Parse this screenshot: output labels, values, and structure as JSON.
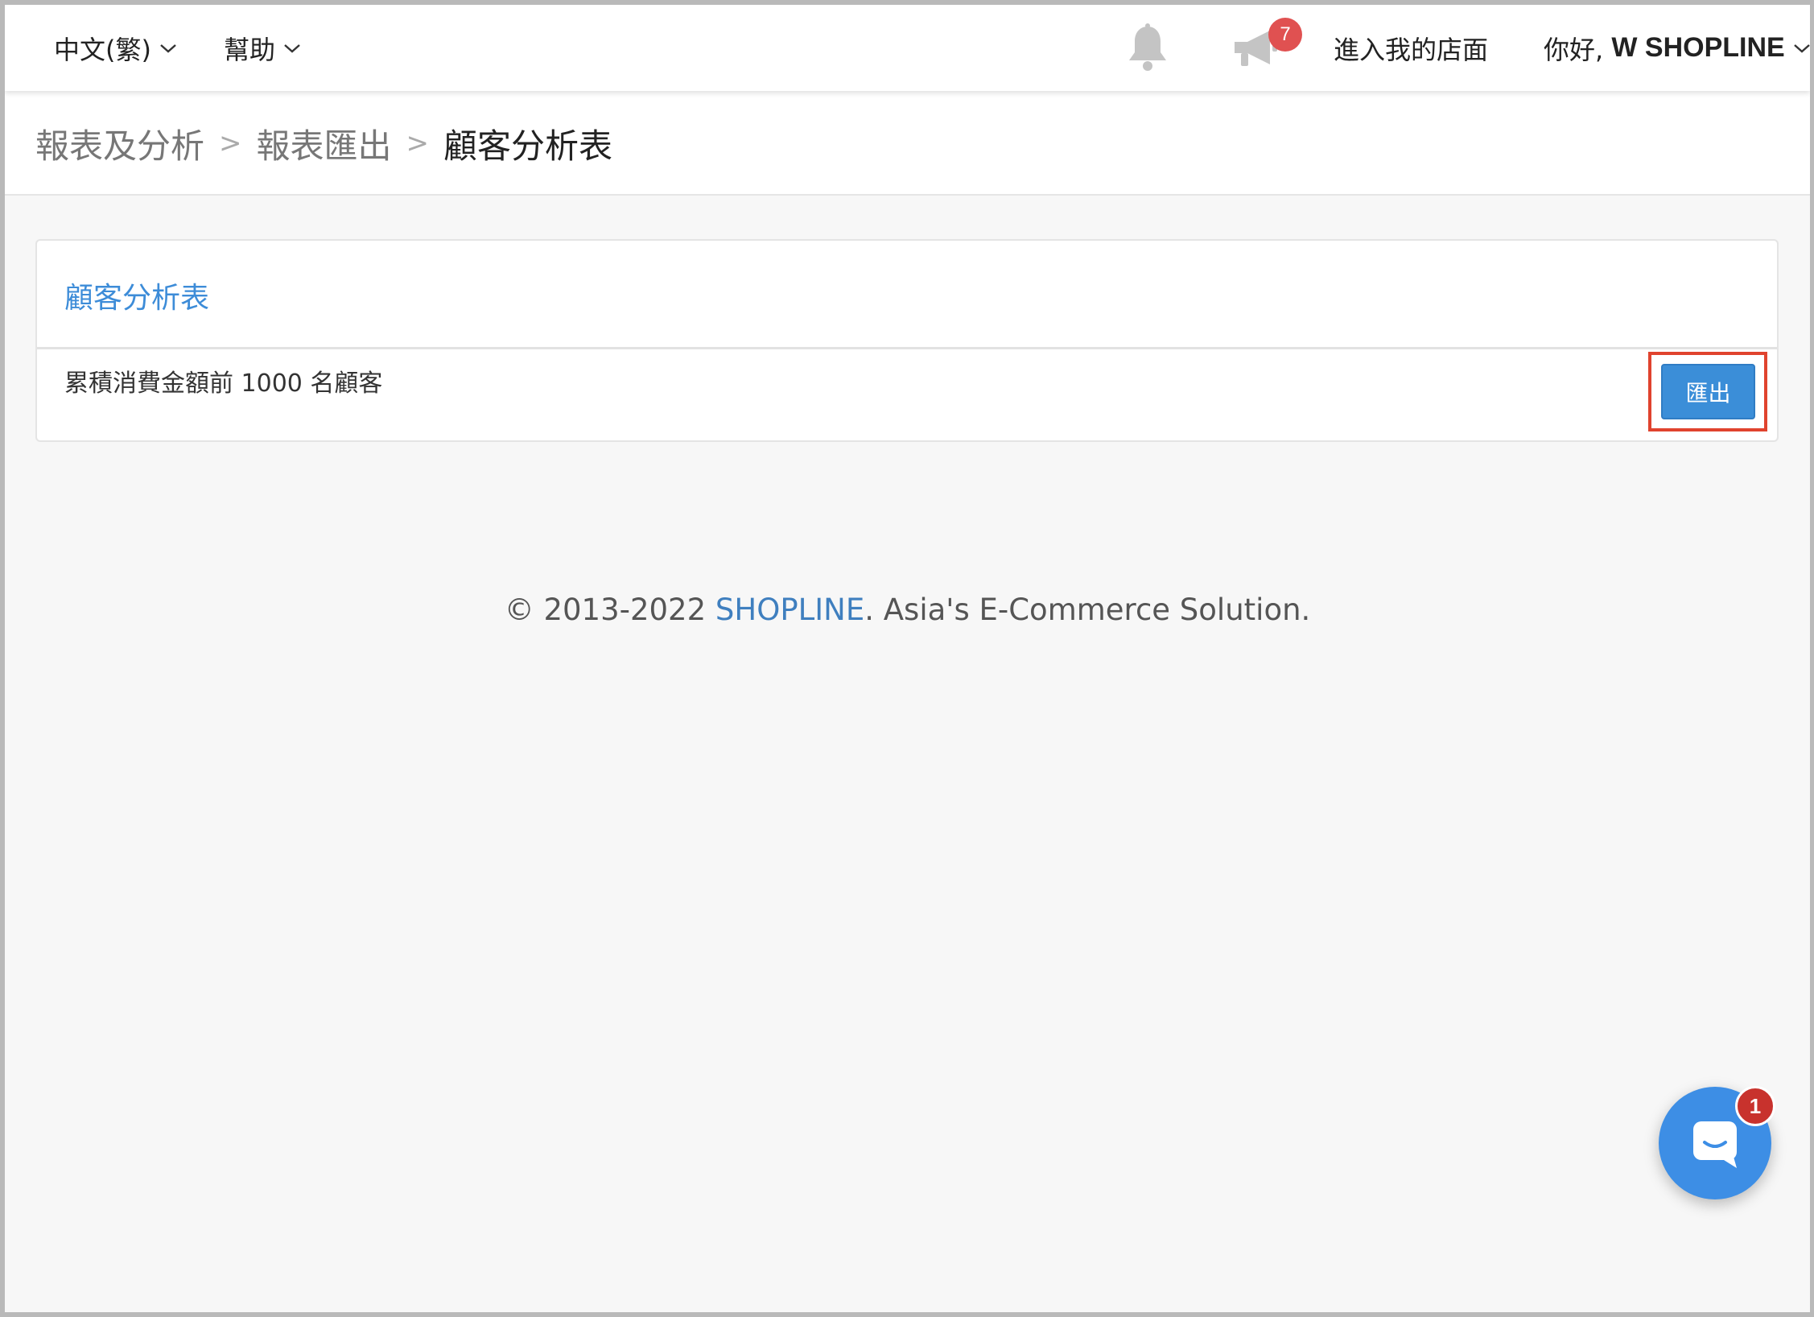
{
  "topbar": {
    "language": {
      "label": "中文(繁)",
      "icon": "chevron-down-icon"
    },
    "help": {
      "label": "幫助",
      "icon": "chevron-down-icon"
    },
    "notifications": {
      "icon": "bell-icon"
    },
    "announcements": {
      "icon": "megaphone-icon",
      "badge": "7"
    },
    "storefront_link": "進入我的店面",
    "greeting": {
      "prefix": "你好, ",
      "name": "W SHOPLINE",
      "icon": "chevron-down-icon"
    }
  },
  "breadcrumb": {
    "items": [
      "報表及分析",
      "報表匯出",
      "顧客分析表"
    ],
    "separator": ">"
  },
  "card": {
    "title": "顧客分析表",
    "row_label": "累積消費金額前 1000 名顧客",
    "export_label": "匯出"
  },
  "footer": {
    "prefix": "© 2013-2022 ",
    "brand": "SHOPLINE",
    "suffix": ". Asia's E-Commerce Solution."
  },
  "chat": {
    "icon": "chat-icon",
    "badge": "1"
  },
  "colors": {
    "accent": "#3d8cd8",
    "highlight": "#e0432e",
    "badge": "#e05151"
  }
}
